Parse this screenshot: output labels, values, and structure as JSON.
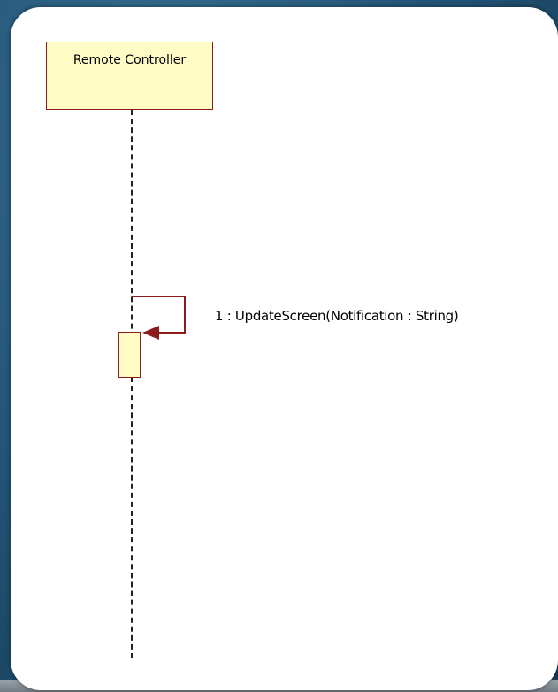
{
  "diagram": {
    "lifeline": {
      "label": "Remote Controller"
    },
    "message": {
      "label": "1 : UpdateScreen(Notification : String)"
    }
  },
  "colors": {
    "fill": "#fffcc6",
    "stroke": "#8c1b1b",
    "background": "#1f4a66"
  }
}
